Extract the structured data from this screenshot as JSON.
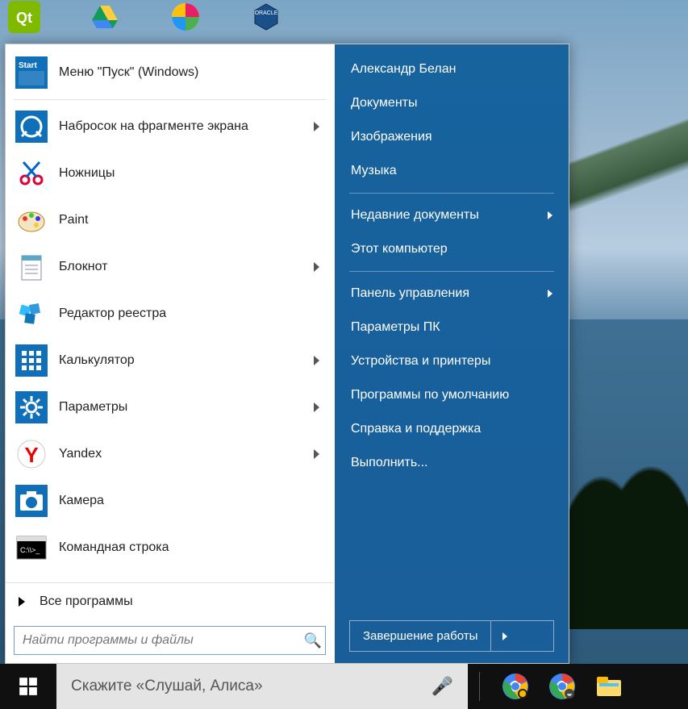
{
  "start_menu": {
    "left": {
      "items": [
        {
          "id": "start-menu-windows",
          "label": "Меню \"Пуск\" (Windows)",
          "has_sub": false
        },
        {
          "id": "snip-sketch",
          "label": "Набросок на фрагменте экрана",
          "has_sub": true
        },
        {
          "id": "snipping-tool",
          "label": "Ножницы",
          "has_sub": false
        },
        {
          "id": "paint",
          "label": "Paint",
          "has_sub": false
        },
        {
          "id": "notepad",
          "label": "Блокнот",
          "has_sub": true
        },
        {
          "id": "regedit",
          "label": "Редактор реестра",
          "has_sub": false
        },
        {
          "id": "calculator",
          "label": "Калькулятор",
          "has_sub": true
        },
        {
          "id": "settings",
          "label": "Параметры",
          "has_sub": true
        },
        {
          "id": "yandex",
          "label": "Yandex",
          "has_sub": true
        },
        {
          "id": "camera",
          "label": "Камера",
          "has_sub": false
        },
        {
          "id": "cmd",
          "label": "Командная строка",
          "has_sub": false
        }
      ],
      "all_programs": "Все программы",
      "search_placeholder": "Найти программы и файлы"
    },
    "right": {
      "user": "Александр Белан",
      "items_a": [
        {
          "label": "Документы"
        },
        {
          "label": "Изображения"
        },
        {
          "label": "Музыка"
        }
      ],
      "items_b": [
        {
          "label": "Недавние документы",
          "has_sub": true
        },
        {
          "label": "Этот компьютер"
        }
      ],
      "items_c": [
        {
          "label": "Панель управления",
          "has_sub": true
        },
        {
          "label": "Параметры ПК"
        },
        {
          "label": "Устройства и принтеры"
        },
        {
          "label": "Программы по умолчанию"
        },
        {
          "label": "Справка и поддержка"
        },
        {
          "label": "Выполнить..."
        }
      ],
      "shutdown": "Завершение работы"
    }
  },
  "taskbar": {
    "cortana_text": "Скажите «Слушай, Алиса»"
  }
}
